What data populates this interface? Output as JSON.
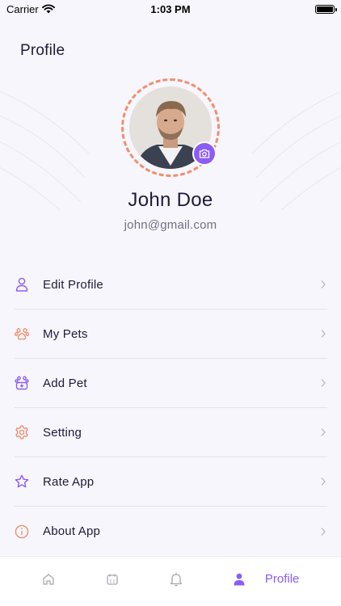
{
  "status_bar": {
    "carrier": "Carrier",
    "time": "1:03 PM"
  },
  "header": {
    "title": "Profile"
  },
  "user": {
    "name": "John Doe",
    "email": "john@gmail.com"
  },
  "menu": {
    "items": [
      {
        "label": "Edit Profile",
        "icon": "user-icon"
      },
      {
        "label": "My Pets",
        "icon": "paw-icon"
      },
      {
        "label": "Add Pet",
        "icon": "paw-plus-icon"
      },
      {
        "label": "Setting",
        "icon": "gear-icon"
      },
      {
        "label": "Rate App",
        "icon": "star-icon"
      },
      {
        "label": "About App",
        "icon": "info-icon"
      }
    ]
  },
  "tab_bar": {
    "tabs": [
      {
        "icon": "home-icon"
      },
      {
        "icon": "calendar-icon"
      },
      {
        "icon": "bell-icon"
      },
      {
        "icon": "person-icon",
        "label": "Profile",
        "active": true
      }
    ]
  },
  "colors": {
    "accent": "#8b5cf6",
    "coral": "#ef8f6e",
    "text": "#1e1b3a",
    "muted": "#707080"
  }
}
